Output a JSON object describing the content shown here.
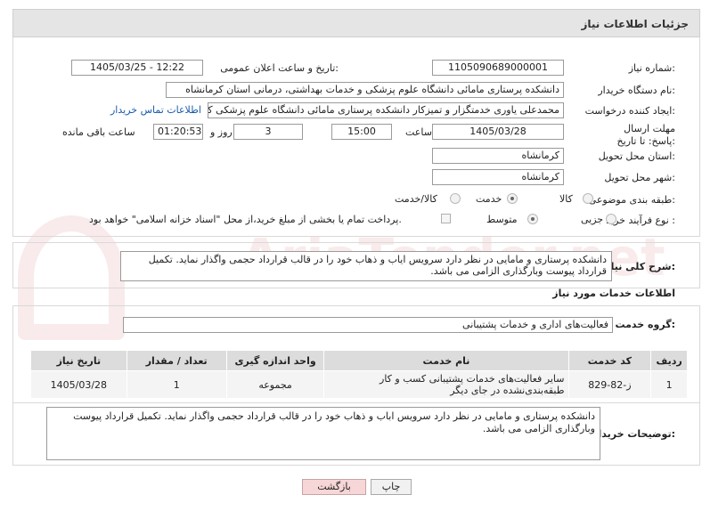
{
  "header": {
    "title": "جزئیات اطلاعات نیاز"
  },
  "form": {
    "need_number_label": "شماره نیاز:",
    "need_number": "1105090689000001",
    "announce_label": "تاریخ و ساعت اعلان عمومی:",
    "announce_value": "1405/03/25 - 12:22",
    "buyer_org_label": "نام دستگاه خریدار:",
    "buyer_org": "دانشکده پرستاری مامائی دانشگاه علوم پزشکی و خدمات بهداشتی، درمانی استان کرمانشاه",
    "requester_label": "ایجاد کننده درخواست:",
    "requester": "محمدعلی یاوری خدمتگزار و تمیزکار دانشکده پرستاری مامائی دانشگاه علوم پزشکی کرمانشاه",
    "buyer_contact_link": "اطلاعات تماس خریدار",
    "deadline_label": "مهلت ارسال پاسخ: تا تاریخ:",
    "deadline_date": "1405/03/28",
    "time_label": "ساعت",
    "deadline_time": "15:00",
    "days_value": "3",
    "days_label": "روز و",
    "remaining_time": "01:20:53",
    "remaining_label": "ساعت باقی مانده",
    "province_label": "استان محل تحویل:",
    "province": "کرمانشاه",
    "city_label": "شهر محل تحویل:",
    "city": "کرمانشاه",
    "category_label": "طبقه بندی موضوعی:",
    "category_options": [
      "کالا",
      "خدمت",
      "کالا/خدمت"
    ],
    "category_selected": "خدمت",
    "process_label": "نوع فرآیند خرید :",
    "process_options": [
      "جزیی",
      "متوسط"
    ],
    "process_selected": "متوسط",
    "payment_note": "پرداخت تمام یا بخشی از مبلغ خرید،از محل \"اسناد خزانه اسلامی\" خواهد بود."
  },
  "summary": {
    "label": "شرح کلی نیاز:",
    "text": "دانشکده پرستاری و مامایی در نظر دارد سرویس ایاب و ذهاب خود را در قالب قرارداد حجمی واگذار نماید. تکمیل قرارداد پیوست وبارگذاری الزامی می باشد."
  },
  "services": {
    "section_title": "اطلاعات خدمات مورد نیاز",
    "group_label": "گروه خدمت:",
    "group_value": "فعالیت‌های اداری و خدمات پشتیبانی",
    "columns": [
      "ردیف",
      "کد خدمت",
      "نام خدمت",
      "واحد اندازه گیری",
      "تعداد / مقدار",
      "تاریخ نیاز"
    ],
    "rows": [
      [
        "1",
        "ز-82-829",
        "سایر فعالیت‌های خدمات پشتیبانی کسب و کار طبقه‌بندی‌نشده در جای دیگر",
        "مجموعه",
        "1",
        "1405/03/28"
      ]
    ]
  },
  "buyer_notes": {
    "label": "توضیحات خریدار:",
    "text": "دانشکده پرستاری و مامایی در نظر دارد سرویس اباب و ذهاب خود را در قالب قرارداد حجمی واگذار نماید. تکمیل قرارداد پیوست وبارگذاری الزامی می باشد."
  },
  "buttons": {
    "print": "چاپ",
    "back": "بازگشت"
  },
  "watermark": "AriaTender.net"
}
